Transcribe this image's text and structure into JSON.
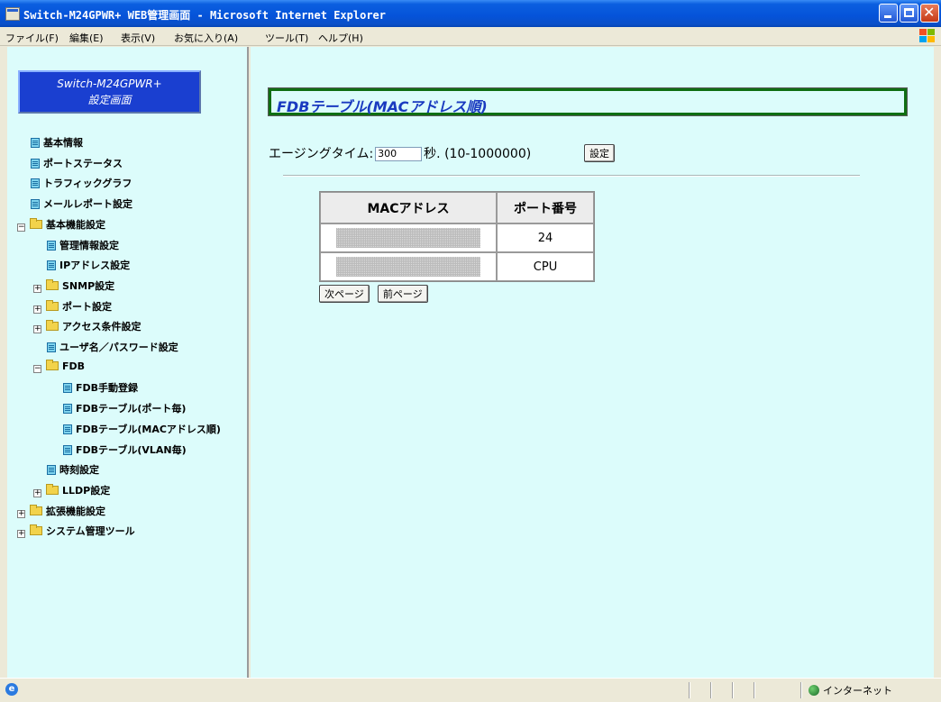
{
  "window": {
    "title": "Switch-M24GPWR+ WEB管理画面 - Microsoft Internet Explorer"
  },
  "menu": [
    "ファイル(F)",
    "編集(E)",
    "表示(V)",
    "お気に入り(A)",
    "ツール(T)",
    "ヘルプ(H)"
  ],
  "brand": {
    "line1": "Switch-M24GPWR+",
    "line2": "設定画面"
  },
  "tree": [
    {
      "label": "基本情報",
      "type": "page",
      "level": 0
    },
    {
      "label": "ポートステータス",
      "type": "page",
      "level": 0
    },
    {
      "label": "トラフィックグラフ",
      "type": "page",
      "level": 0
    },
    {
      "label": "メールレポート設定",
      "type": "page",
      "level": 0
    },
    {
      "label": "基本機能設定",
      "type": "folder",
      "level": 0,
      "expanded": true
    },
    {
      "label": "管理情報設定",
      "type": "page",
      "level": 1
    },
    {
      "label": "IPアドレス設定",
      "type": "page",
      "level": 1
    },
    {
      "label": "SNMP設定",
      "type": "folder",
      "level": 1,
      "expanded": false
    },
    {
      "label": "ポート設定",
      "type": "folder",
      "level": 1,
      "expanded": false
    },
    {
      "label": "アクセス条件設定",
      "type": "folder",
      "level": 1,
      "expanded": false
    },
    {
      "label": "ユーザ名／パスワード設定",
      "type": "page",
      "level": 1
    },
    {
      "label": "FDB",
      "type": "folder",
      "level": 1,
      "expanded": true
    },
    {
      "label": "FDB手動登録",
      "type": "page",
      "level": 2
    },
    {
      "label": "FDBテーブル(ポート毎)",
      "type": "page",
      "level": 2
    },
    {
      "label": "FDBテーブル(MACアドレス順)",
      "type": "page",
      "level": 2
    },
    {
      "label": "FDBテーブル(VLAN毎)",
      "type": "page",
      "level": 2
    },
    {
      "label": "時刻設定",
      "type": "page",
      "level": 1
    },
    {
      "label": "LLDP設定",
      "type": "folder",
      "level": 1,
      "expanded": false
    },
    {
      "label": "拡張機能設定",
      "type": "folder",
      "level": 0,
      "expanded": false
    },
    {
      "label": "システム管理ツール",
      "type": "folder",
      "level": 0,
      "expanded": false
    }
  ],
  "main": {
    "title": "FDBテーブル(MACアドレス順)",
    "aging_label": "エージングタイム:",
    "aging_value": "300",
    "aging_suffix": "秒. (10-1000000)",
    "set_button": "設定",
    "table": {
      "headers": [
        "MACアドレス",
        "ポート番号"
      ],
      "rows": [
        {
          "mac": "",
          "port": "24"
        },
        {
          "mac": "",
          "port": "CPU"
        }
      ]
    },
    "next_button": "次ページ",
    "prev_button": "前ページ"
  },
  "status": {
    "zone": "インターネット"
  },
  "colors": {
    "frame_bg": "#dcfcfb",
    "title_border": "#0f6e12",
    "title_text": "#1a3ac0",
    "brand_bg": "#1a3fd0"
  }
}
